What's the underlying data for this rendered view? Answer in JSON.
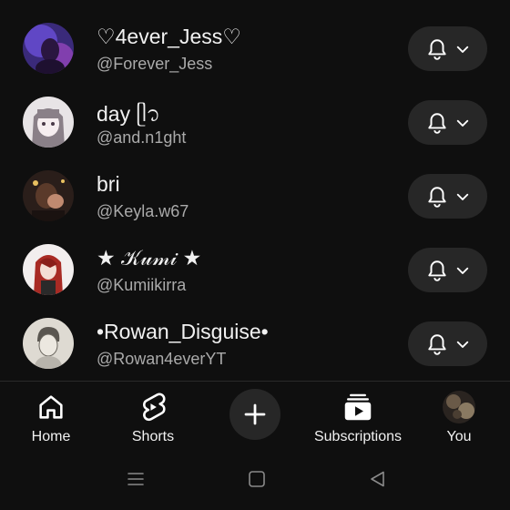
{
  "channels": [
    {
      "name": "♡4ever_Jess♡",
      "handle": "@Forever_Jess",
      "avatar": "avatar-purple-portrait"
    },
    {
      "name": "day ᥫ᭡",
      "handle": "@and.n1ght",
      "avatar": "avatar-anime-girl"
    },
    {
      "name": "bri",
      "handle": "@Keyla.w67",
      "avatar": "avatar-dark-photo"
    },
    {
      "name": "★ 𝒦𝓊𝓂𝒾 ★",
      "handle": "@Kumiikirra",
      "avatar": "avatar-red-hair"
    },
    {
      "name": "•Rowan_Disguise•",
      "handle": "@Rowan4everYT",
      "avatar": "avatar-sketch-portrait"
    }
  ],
  "bell_button": {
    "icon": "bell-icon",
    "dropdown_icon": "chevron-down-icon"
  },
  "nav": {
    "home": "Home",
    "shorts": "Shorts",
    "create": "create-plus-icon",
    "subscriptions": "Subscriptions",
    "you": "You"
  },
  "system_nav": [
    "menu-lines-icon",
    "home-square-icon",
    "back-triangle-icon"
  ],
  "colors": {
    "background": "#0f0f0f",
    "button_bg": "#272727",
    "secondary_text": "#aaaaaa"
  }
}
